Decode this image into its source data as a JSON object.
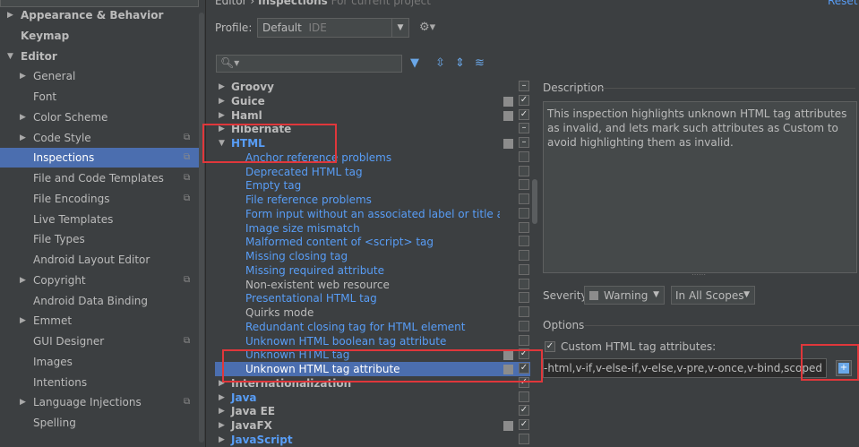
{
  "sidebar": {
    "items": [
      {
        "label": "Appearance & Behavior",
        "arrow": "▶",
        "level": 0,
        "bold": true
      },
      {
        "label": "Keymap",
        "arrow": "",
        "level": 0,
        "bold": true
      },
      {
        "label": "Editor",
        "arrow": "▼",
        "level": 0,
        "bold": true
      },
      {
        "label": "General",
        "arrow": "▶",
        "level": 1
      },
      {
        "label": "Font",
        "arrow": "",
        "level": 1
      },
      {
        "label": "Color Scheme",
        "arrow": "▶",
        "level": 1
      },
      {
        "label": "Code Style",
        "arrow": "▶",
        "level": 1,
        "copy": true
      },
      {
        "label": "Inspections",
        "arrow": "",
        "level": 1,
        "copy": true,
        "selected": true
      },
      {
        "label": "File and Code Templates",
        "arrow": "",
        "level": 1,
        "copy": true
      },
      {
        "label": "File Encodings",
        "arrow": "",
        "level": 1,
        "copy": true
      },
      {
        "label": "Live Templates",
        "arrow": "",
        "level": 1
      },
      {
        "label": "File Types",
        "arrow": "",
        "level": 1
      },
      {
        "label": "Android Layout Editor",
        "arrow": "",
        "level": 1
      },
      {
        "label": "Copyright",
        "arrow": "▶",
        "level": 1,
        "copy": true
      },
      {
        "label": "Android Data Binding",
        "arrow": "",
        "level": 1
      },
      {
        "label": "Emmet",
        "arrow": "▶",
        "level": 1
      },
      {
        "label": "GUI Designer",
        "arrow": "",
        "level": 1,
        "copy": true
      },
      {
        "label": "Images",
        "arrow": "",
        "level": 1
      },
      {
        "label": "Intentions",
        "arrow": "",
        "level": 1
      },
      {
        "label": "Language Injections",
        "arrow": "▶",
        "level": 1,
        "copy": true
      },
      {
        "label": "Spelling",
        "arrow": "",
        "level": 1
      }
    ]
  },
  "header": {
    "breadcrumb_a": "Editor",
    "breadcrumb_sep": "›",
    "breadcrumb_b": "Inspections",
    "breadcrumb_hint": "For current project",
    "reset": "Reset",
    "profile_label": "Profile:",
    "profile_value": "Default",
    "profile_scope": "IDE"
  },
  "tree": {
    "search_placeholder": "",
    "rows": [
      {
        "label": "Groovy",
        "type": "grp",
        "arrow": "▶",
        "sev": false,
        "check": "–"
      },
      {
        "label": "Guice",
        "type": "grp",
        "arrow": "▶",
        "sev": true,
        "check": "✓"
      },
      {
        "label": "Haml",
        "type": "grp",
        "arrow": "▶",
        "sev": true,
        "check": "✓"
      },
      {
        "label": "Hibernate",
        "type": "grp",
        "arrow": "▶",
        "sev": false,
        "check": "–"
      },
      {
        "label": "HTML",
        "type": "grp",
        "blue": true,
        "arrow": "▼",
        "sev": true,
        "check": "–"
      },
      {
        "label": "Anchor reference problems",
        "type": "item",
        "check": ""
      },
      {
        "label": "Deprecated HTML tag",
        "type": "item",
        "check": ""
      },
      {
        "label": "Empty tag",
        "type": "item",
        "check": ""
      },
      {
        "label": "File reference problems",
        "type": "item",
        "check": ""
      },
      {
        "label": "Form input without an associated label or title attribute",
        "type": "item",
        "check": ""
      },
      {
        "label": "Image size mismatch",
        "type": "item",
        "check": ""
      },
      {
        "label": "Malformed content of <script> tag",
        "type": "item",
        "check": ""
      },
      {
        "label": "Missing closing tag",
        "type": "item",
        "check": ""
      },
      {
        "label": "Missing required attribute",
        "type": "item",
        "check": ""
      },
      {
        "label": "Non-existent web resource",
        "type": "item",
        "plain": true,
        "check": ""
      },
      {
        "label": "Presentational HTML tag",
        "type": "item",
        "check": ""
      },
      {
        "label": "Quirks mode",
        "type": "item",
        "plain": true,
        "check": ""
      },
      {
        "label": "Redundant closing tag for HTML element",
        "type": "item",
        "check": ""
      },
      {
        "label": "Unknown HTML boolean tag attribute",
        "type": "item",
        "check": ""
      },
      {
        "label": "Unknown HTML tag",
        "type": "item",
        "sev": true,
        "check": "✓"
      },
      {
        "label": "Unknown HTML tag attribute",
        "type": "item",
        "sev": true,
        "check": "✓",
        "selected": true
      },
      {
        "label": "Internationalization",
        "type": "grp",
        "arrow": "▶",
        "sev": false,
        "check": "✓"
      },
      {
        "label": "Java",
        "type": "grp",
        "blue": true,
        "arrow": "▶",
        "sev": false,
        "check": ""
      },
      {
        "label": "Java EE",
        "type": "grp",
        "arrow": "▶",
        "sev": false,
        "check": "✓"
      },
      {
        "label": "JavaFX",
        "type": "grp",
        "arrow": "▶",
        "sev": true,
        "check": "✓"
      },
      {
        "label": "JavaScript",
        "type": "grp",
        "blue": true,
        "arrow": "▶",
        "sev": false,
        "check": ""
      }
    ]
  },
  "details": {
    "description_title": "Description",
    "description_text": "This inspection highlights unknown HTML tag attributes as invalid, and lets mark such attributes as Custom to avoid highlighting them as invalid.",
    "severity_label": "Severity:",
    "severity_value": "Warning",
    "scope_value": "In All Scopes",
    "options_title": "Options",
    "custom_attrs_label": "Custom HTML tag attributes:",
    "custom_attrs_checked": "✓",
    "custom_attrs_value": "v-text,v-html,v-if,v-else-if,v-else,v-pre,v-once,v-bind,scoped"
  },
  "colors": {
    "background": "#3c3f41",
    "selection": "#4b6eaf",
    "link": "#589df6",
    "annotation": "#e0373b"
  }
}
